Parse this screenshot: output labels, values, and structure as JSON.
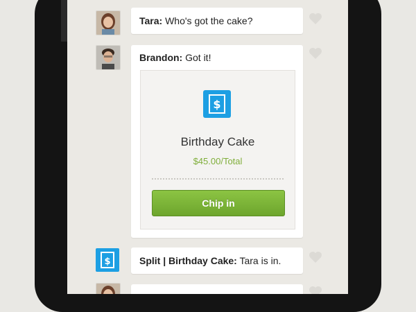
{
  "colors": {
    "accent_blue": "#1d9fe3",
    "chip_green": "#7fae3a",
    "background": "#ebe9e4"
  },
  "feed": {
    "messages": [
      {
        "author": "Tara:",
        "text": " Who's got the cake?",
        "icon": "avatar"
      },
      {
        "author": "Brandon:",
        "text": " Got it!",
        "icon": "avatar"
      },
      {
        "author": "Split | Birthday Cake:",
        "text": " Tara is in.",
        "icon": "split-receipt-icon"
      }
    ],
    "receipt": {
      "title": "Birthday Cake",
      "amount": "$45.00/Total",
      "button_label": "Chip in",
      "icon": "receipt-dollar-icon"
    }
  }
}
